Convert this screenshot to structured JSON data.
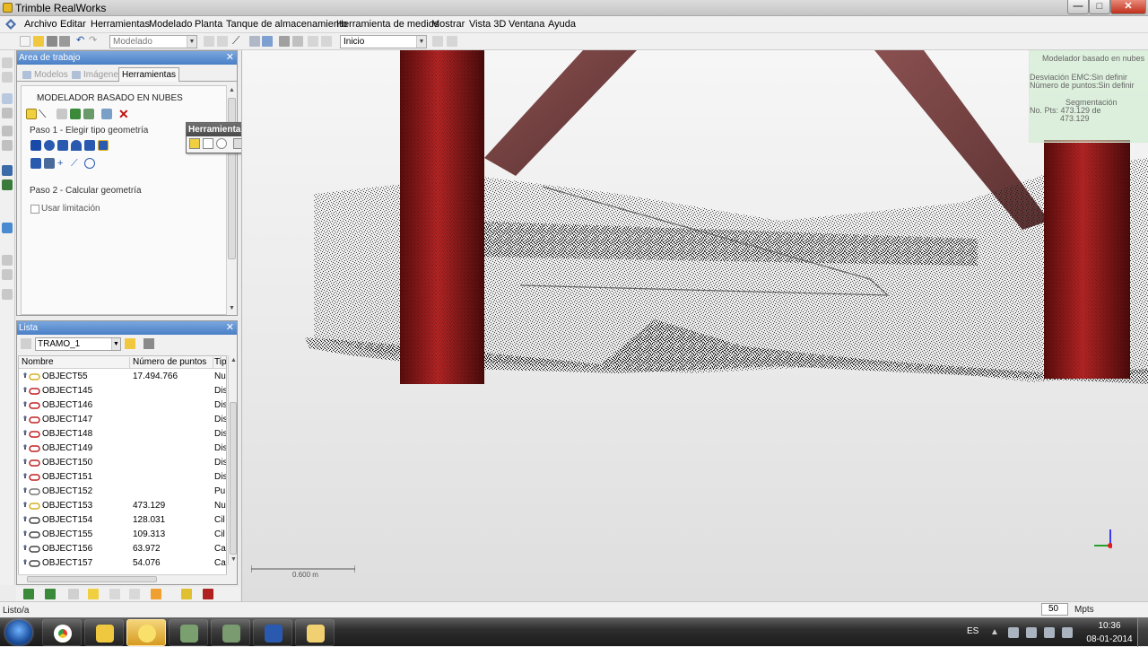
{
  "window": {
    "title": "Trimble RealWorks",
    "min": "—",
    "max": "□",
    "close": "✕"
  },
  "menu": {
    "items": [
      "Archivo",
      "Editar",
      "Herramientas",
      "Modelado",
      "Planta",
      "Tanque de almacenamiento",
      "Herramienta de medios",
      "Mostrar",
      "Vista 3D",
      "Ventana",
      "Ayuda"
    ]
  },
  "toolbar": {
    "mode_combo": "Modelado",
    "view_combo": "Inicio"
  },
  "work_panel": {
    "title": "Area de trabajo",
    "tabs": [
      "Modelos",
      "Imágenes",
      "Herramientas"
    ],
    "section_title": "MODELADOR BASADO EN NUBES",
    "step1": "Paso 1 - Elegir tipo geometría",
    "step2": "Paso 2 - Calcular geometría",
    "checkbox_label": "Usar limitación"
  },
  "seg_popup": {
    "title": "Herramienta Segmentación"
  },
  "list_panel": {
    "title": "Lista",
    "combo": "TRAMO_1",
    "columns": [
      "Nombre",
      "Número de puntos",
      "Tip"
    ],
    "rows": [
      {
        "name": "OBJECT55",
        "points": "17.494.766",
        "type": "Nu",
        "icon": "cloud-icon"
      },
      {
        "name": "OBJECT145",
        "points": "",
        "type": "Dis",
        "icon": "distance-icon"
      },
      {
        "name": "OBJECT146",
        "points": "",
        "type": "Dis",
        "icon": "distance-icon"
      },
      {
        "name": "OBJECT147",
        "points": "",
        "type": "Dis",
        "icon": "distance-icon"
      },
      {
        "name": "OBJECT148",
        "points": "",
        "type": "Dis",
        "icon": "distance-icon"
      },
      {
        "name": "OBJECT149",
        "points": "",
        "type": "Dis",
        "icon": "distance-icon"
      },
      {
        "name": "OBJECT150",
        "points": "",
        "type": "Dis",
        "icon": "distance-icon"
      },
      {
        "name": "OBJECT151",
        "points": "",
        "type": "Dis",
        "icon": "distance-icon"
      },
      {
        "name": "OBJECT152",
        "points": "",
        "type": "Pu",
        "icon": "point-icon"
      },
      {
        "name": "OBJECT153",
        "points": "473.129",
        "type": "Nu",
        "icon": "cloud-icon"
      },
      {
        "name": "OBJECT154",
        "points": "128.031",
        "type": "Cil",
        "icon": "cylinder-icon"
      },
      {
        "name": "OBJECT155",
        "points": "109.313",
        "type": "Cil",
        "icon": "cylinder-icon"
      },
      {
        "name": "OBJECT156",
        "points": "63.972",
        "type": "Ca",
        "icon": "box-icon"
      },
      {
        "name": "OBJECT157",
        "points": "54.076",
        "type": "Ca",
        "icon": "box-icon"
      }
    ]
  },
  "viewport": {
    "info_title": "Modelador basado en nubes",
    "info_emc": "Desviación EMC:Sin definir",
    "info_points": "Número de puntos:Sin definir",
    "info_seg": "Segmentación",
    "info_pts": "No. Pts: 473.129 de",
    "info_total": "473.129",
    "scale_label": "0.600 m"
  },
  "status": {
    "text": "Listo/a",
    "mpts_value": "50",
    "mpts_unit": "Mpts"
  },
  "taskbar": {
    "lang": "ES",
    "time": "10:36",
    "date": "08-01-2014"
  },
  "colors": {
    "accent": "#4a7fc6",
    "column": "#8e1a1a",
    "beam": "#7a4444"
  }
}
